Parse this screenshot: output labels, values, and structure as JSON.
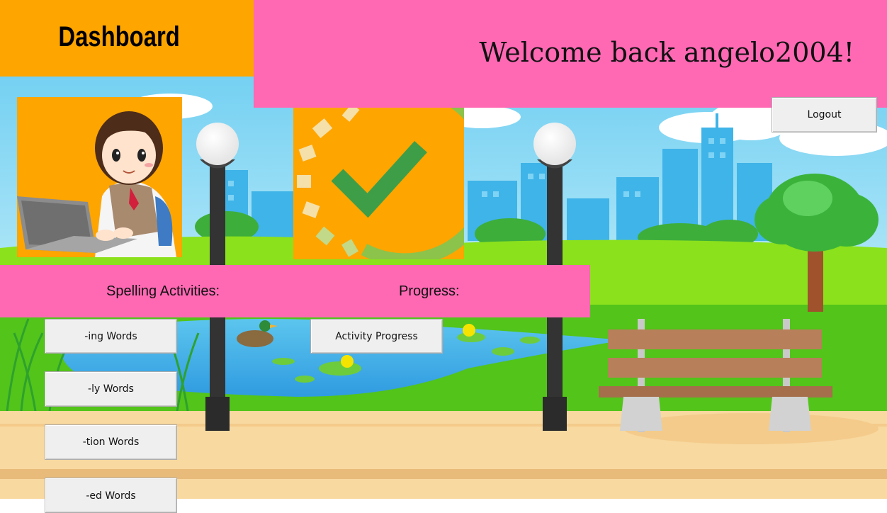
{
  "header": {
    "title": "Dashboard",
    "welcome": "Welcome back angelo2004!"
  },
  "buttons": {
    "logout": "Logout",
    "activity_progress": "Activity Progress",
    "ing_words": "-ing Words",
    "ly_words": "-ly Words",
    "tion_words": "-tion Words",
    "ed_words": "-ed Words"
  },
  "sections": {
    "spelling": "Spelling Activities:",
    "progress": "Progress:"
  },
  "images": {
    "avatar": "teacher-at-laptop-illustration",
    "progress": "checkmark-progress-icon",
    "background": "park-scene-illustration"
  },
  "colors": {
    "orange": "#FFA500",
    "pink": "#FF69B4",
    "button_bg": "#EFEFEF"
  }
}
